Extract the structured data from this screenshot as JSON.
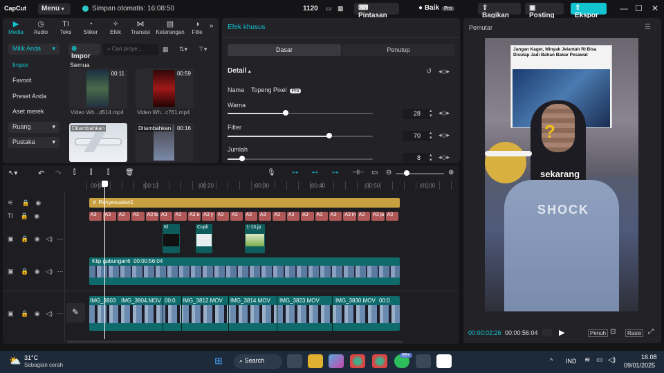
{
  "titlebar": {
    "logo": "CapCut",
    "menu": "Menu",
    "autosave": "Simpan otomatis: 16:08:50",
    "resolution": "1120",
    "shortcut": "Pintasan",
    "account": "Baik",
    "pro_badge": "Pro",
    "share": "Bagikan",
    "post": "Posting",
    "export": "Ekspor"
  },
  "media": {
    "tools": [
      "Media",
      "Audio",
      "Teks",
      "Stiker",
      "Efek",
      "Transisi",
      "Keterangan",
      "Filte"
    ],
    "tool_icons": [
      "media-icon",
      "audio-icon",
      "text-icon",
      "sticker-icon",
      "effect-icon",
      "transition-icon",
      "caption-icon",
      "filter-icon"
    ],
    "nav": [
      "Milik Anda",
      "Impor",
      "Favorit",
      "Preset Anda",
      "Aset merek",
      "Ruang",
      "Pustaka"
    ],
    "import_btn": "Impor",
    "search_placeholder": "Cari proye...",
    "section": "Semua",
    "items": [
      {
        "tag": "",
        "duration": "00:11",
        "caption": "Video Wh...d514.mp4"
      },
      {
        "tag": "",
        "duration": "00:59",
        "caption": "Video Wh...c761.mp4"
      },
      {
        "tag": "Ditambahkan",
        "duration": "",
        "caption": ""
      },
      {
        "tag": "Ditambahkan",
        "duration": "00:16",
        "caption": ""
      }
    ]
  },
  "effect": {
    "title": "Efek khusus",
    "tab_basic": "Dasar",
    "tab_close": "Penutup",
    "detail": "Detail",
    "name_label": "Nama",
    "name_value": "Topeng Pixel",
    "name_badge": "Pro",
    "params": [
      {
        "label": "Warna",
        "value": "28",
        "fraction": 0.4
      },
      {
        "label": "Filter",
        "value": "70",
        "fraction": 0.7
      },
      {
        "label": "Jumlah",
        "value": "8",
        "fraction": 0.1
      }
    ]
  },
  "timeline": {
    "ruler": [
      "00:00",
      "|00:10",
      "|00:20",
      "|00:30",
      "|00:40",
      "|00:50",
      "|01:00"
    ],
    "adjust_clip": "Penyesuaian1",
    "text_clips": [
      "A3",
      "A3",
      "A3",
      "A3",
      "A3 ba",
      "A3",
      "A3",
      "A3 a",
      "A3 y",
      "A3",
      "A3",
      "A3",
      "A3",
      "A3",
      "A3",
      "A3",
      "A3",
      "A3",
      "A3 in",
      "A3",
      "A3 ja",
      "A3"
    ],
    "overlay_clips": [
      "Kl",
      "Cupli",
      "1-13.jp"
    ],
    "compound_clip": "Klip gabungan6",
    "compound_duration": "00:00:56:04",
    "main_clips": [
      "IMG_3803",
      "IMG_3804.MOV",
      "00:0",
      "IMG_3812.MOV",
      "IMG_3814.MOV",
      "IMG_3823.MOV",
      "IMG_3830.MOV",
      "00:0"
    ],
    "main_clip_times": [
      "",
      "",
      "",
      "",
      "",
      "00:00:12"
    ]
  },
  "player": {
    "title": "Pemutar",
    "current": "00:00:02:26",
    "total": "00:00:56:04",
    "full": "Penuh",
    "ratio": "Rasio",
    "headline": "Jangan Kaget, Minyak Jelantah RI Bisa Disulap Jadi Bahan Bakar Pesawat",
    "caption_word": "sekarang",
    "shirt_text": "SHOCK"
  },
  "taskbar": {
    "weather_temp": "31°C",
    "weather_desc": "Sebagian cerah",
    "search": "Search",
    "badge": "99+",
    "lang": "IND",
    "time": "16.08",
    "date": "09/01/2025"
  },
  "colors": {
    "accent": "#12c3d0",
    "adjust": "#c9a040",
    "textclip": "#b05858",
    "videoclip": "#0f6b6b"
  }
}
